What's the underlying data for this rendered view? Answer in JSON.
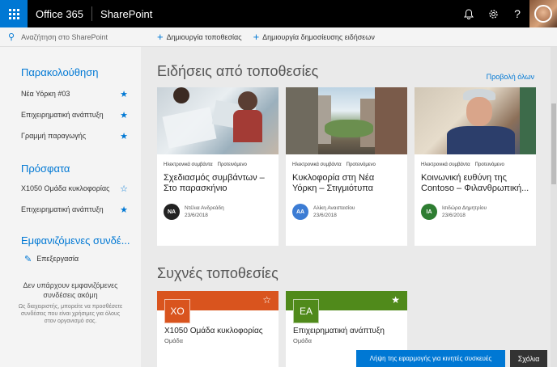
{
  "suite": {
    "brand": "Office 365",
    "app": "SharePoint",
    "bell_icon": "bell-icon",
    "gear_icon": "gear-icon",
    "help_icon": "help-icon",
    "help_glyph": "?"
  },
  "sidebar": {
    "search_placeholder": "Αναζήτηση στο SharePoint",
    "following": {
      "title": "Παρακολούθηση",
      "items": [
        {
          "label": "Νέα Υόρκη #03"
        },
        {
          "label": "Επιχειρηματική ανάπτυξη"
        },
        {
          "label": "Γραμμή παραγωγής"
        }
      ]
    },
    "recent": {
      "title": "Πρόσφατα",
      "items": [
        {
          "label": "X1050 Ομάδα κυκλοφορίας"
        },
        {
          "label": "Επιχειρηματική ανάπτυξη"
        }
      ]
    },
    "featured": {
      "title": "Εμφανιζόμενες συνδέ...",
      "edit_label": "Επεξεργασία",
      "empty_title": "Δεν υπάρχουν εμφανιζόμενες συνδέσεις ακόμη",
      "empty_desc": "Ως διαχειριστής, μπορείτε να προσθέσετε συνδέσεις που είναι χρήσιμες για όλους στον οργανισμό σας."
    }
  },
  "commands": {
    "create_site": "Δημιουργία τοποθεσίας",
    "create_news": "Δημιουργία δημοσίευσης ειδήσεων"
  },
  "news": {
    "title": "Ειδήσεις από τοποθεσίες",
    "see_all": "Προβολή όλων",
    "cards": [
      {
        "category": "Ηλεκτρονικά συμβάντα",
        "tag": "Προτεινόμενο",
        "title": "Σχεδιασμός συμβάντων – Στο παρασκήνιο",
        "initials": "NA",
        "author": "Ντέλια Ανδρεάδη",
        "date": "23/6/2018",
        "avatar_color": "#222222"
      },
      {
        "category": "Ηλεκτρονικά συμβάντα",
        "tag": "Προτεινόμενο",
        "title": "Κυκλοφορία στη Νέα Υόρκη – Στιγμιότυπα",
        "initials": "AA",
        "author": "Αλίκη Αναστασίου",
        "date": "23/6/2018",
        "avatar_color": "#3c7cd4"
      },
      {
        "category": "Ηλεκτρονικά συμβάντα",
        "tag": "Προτεινόμενο",
        "title": "Κοινωνική ευθύνη της Contoso – Φιλανθρωπική...",
        "initials": "IA",
        "author": "Ισιδώρα Δημητρίου",
        "date": "23/6/2018",
        "avatar_color": "#2e7d32"
      }
    ]
  },
  "sites": {
    "title": "Συχνές τοποθεσίες",
    "cards": [
      {
        "logo": "XO",
        "name": "X1050 Ομάδα κυκλοφορίας",
        "type": "Ομάδα",
        "color": "#d9541e",
        "starred": false
      },
      {
        "logo": "EA",
        "name": "Επιχειρηματική ανάπτυξη",
        "type": "Ομάδα",
        "color": "#508a1b",
        "starred": true
      }
    ]
  },
  "footer": {
    "mobile_app": "Λήψη της εφαρμογής για κινητές συσκευές",
    "feedback": "Σχόλια"
  }
}
